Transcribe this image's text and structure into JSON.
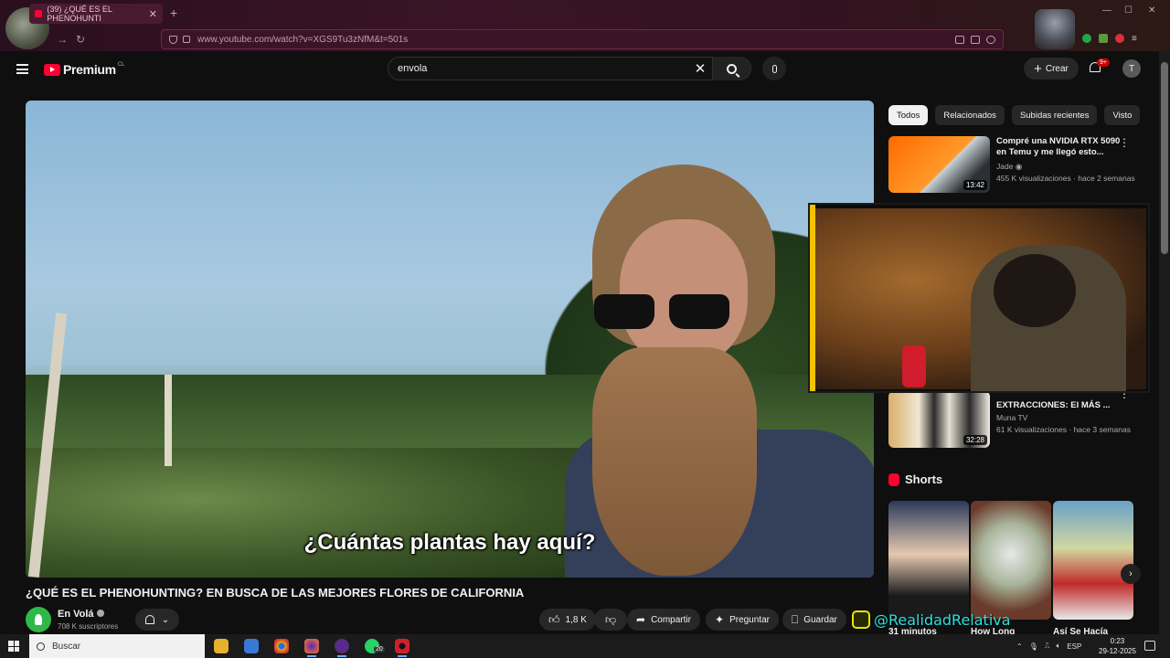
{
  "browser": {
    "tab_title": "(39) ¿QUÉ ES EL PHENOHUNTI",
    "url": "www.youtube.com/watch?v=XGS9Tu3zNfM&t=501s"
  },
  "masthead": {
    "logo_text": "Premium",
    "country_code": "CL",
    "search_value": "envola",
    "create_label": "Crear",
    "notifications_badge": "9+",
    "user_initial": "T"
  },
  "video": {
    "subtitle": "¿Cuántas plantas hay aquí?",
    "title": "¿QUÉ ES EL PHENOHUNTING? EN BUSCA DE LAS MEJORES FLORES DE CALIFORNIA",
    "channel_name": "En Volá",
    "subscribers": "708 K suscriptores",
    "likes": "1,8 K",
    "share_label": "Compartir",
    "ask_label": "Preguntar",
    "save_label": "Guardar"
  },
  "chips": [
    "Todos",
    "Relacionados",
    "Subidas recientes",
    "Visto"
  ],
  "recommendations": [
    {
      "title": "Compré una NVIDIA RTX 5090 en Temu y me llegó esto...",
      "channel": "Jade",
      "meta": "455 K visualizaciones · hace 2 semanas",
      "duration": "13:42"
    },
    {
      "title": "EXTRACCIONES: El MÁS ...",
      "channel": "Muna TV",
      "meta": "61 K visualizaciones · hace 3 semanas",
      "duration": "32:28"
    }
  ],
  "shorts": {
    "heading": "Shorts",
    "items": [
      {
        "label": "31 minutos"
      },
      {
        "label": "How Long"
      },
      {
        "label": "Así Se Hacía"
      }
    ]
  },
  "overlay": {
    "handle": "@RealidadRelativa"
  },
  "taskbar": {
    "search_placeholder": "Buscar",
    "whatsapp_badge": "20",
    "language": "ESP",
    "time": "0:23",
    "date": "29-12-2025"
  },
  "colors": {
    "youtube_red": "#ff0033",
    "browser_theme": "#3a1426",
    "overlay_text": "#2fe0e0"
  }
}
